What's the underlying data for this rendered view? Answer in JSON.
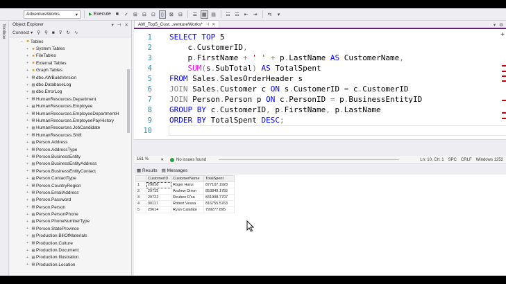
{
  "toolbar": {
    "database": "AdventureWorks",
    "execute_label": "Execute"
  },
  "toolbox": {
    "label": "Toolbox"
  },
  "object_explorer": {
    "title": "Object Explorer",
    "connect_label": "Connect",
    "tree": [
      {
        "label": "Tables",
        "type": "folder",
        "indent": 0,
        "expanded": true
      },
      {
        "label": "System Tables",
        "type": "folder",
        "indent": 1
      },
      {
        "label": "FileTables",
        "type": "folder",
        "indent": 1
      },
      {
        "label": "External Tables",
        "type": "folder",
        "indent": 1
      },
      {
        "label": "Graph Tables",
        "type": "folder",
        "indent": 1
      },
      {
        "label": "dbo.AWBuildVersion",
        "type": "table",
        "indent": 1
      },
      {
        "label": "dbo.DatabaseLog",
        "type": "table",
        "indent": 1
      },
      {
        "label": "dbo.ErrorLog",
        "type": "table",
        "indent": 1
      },
      {
        "label": "HumanResources.Department",
        "type": "table",
        "indent": 1
      },
      {
        "label": "HumanResources.Employee",
        "type": "table",
        "indent": 1
      },
      {
        "label": "HumanResources.EmployeeDepartmentH",
        "type": "table",
        "indent": 1
      },
      {
        "label": "HumanResources.EmployeePayHistory",
        "type": "table",
        "indent": 1
      },
      {
        "label": "HumanResources.JobCandidate",
        "type": "table",
        "indent": 1
      },
      {
        "label": "HumanResources.Shift",
        "type": "table",
        "indent": 1
      },
      {
        "label": "Person.Address",
        "type": "table",
        "indent": 1
      },
      {
        "label": "Person.AddressType",
        "type": "table",
        "indent": 1
      },
      {
        "label": "Person.BusinessEntity",
        "type": "table",
        "indent": 1
      },
      {
        "label": "Person.BusinessEntityAddress",
        "type": "table",
        "indent": 1
      },
      {
        "label": "Person.BusinessEntityContact",
        "type": "table",
        "indent": 1
      },
      {
        "label": "Person.ContactType",
        "type": "table",
        "indent": 1
      },
      {
        "label": "Person.CountryRegion",
        "type": "table",
        "indent": 1
      },
      {
        "label": "Person.EmailAddress",
        "type": "table",
        "indent": 1
      },
      {
        "label": "Person.Password",
        "type": "table",
        "indent": 1
      },
      {
        "label": "Person.Person",
        "type": "table",
        "indent": 1
      },
      {
        "label": "Person.PersonPhone",
        "type": "table",
        "indent": 1
      },
      {
        "label": "Person.PhoneNumberType",
        "type": "table",
        "indent": 1
      },
      {
        "label": "Person.StateProvince",
        "type": "table",
        "indent": 1
      },
      {
        "label": "Production.BillOfMaterials",
        "type": "table",
        "indent": 1
      },
      {
        "label": "Production.Culture",
        "type": "table",
        "indent": 1
      },
      {
        "label": "Production.Document",
        "type": "table",
        "indent": 1
      },
      {
        "label": "Production.Illustration",
        "type": "table",
        "indent": 1
      },
      {
        "label": "Production.Location",
        "type": "table",
        "indent": 1
      }
    ]
  },
  "editor": {
    "tab_title": "AW_Top5_Cust...ventureWorks*",
    "lines": [
      {
        "n": "1",
        "tokens": [
          [
            "kw",
            "SELECT TOP "
          ],
          [
            "id",
            "5"
          ]
        ]
      },
      {
        "n": "2",
        "tokens": [
          [
            "id",
            "    c"
          ],
          [
            "op",
            "."
          ],
          [
            "id",
            "CustomerID"
          ],
          [
            "op",
            ","
          ]
        ]
      },
      {
        "n": "3",
        "tokens": [
          [
            "id",
            "    p"
          ],
          [
            "op",
            "."
          ],
          [
            "id",
            "FirstName "
          ],
          [
            "op",
            "+ "
          ],
          [
            "str",
            "' '"
          ],
          [
            "op",
            " + "
          ],
          [
            "id",
            "p"
          ],
          [
            "op",
            "."
          ],
          [
            "id",
            "LastName "
          ],
          [
            "kw",
            "AS"
          ],
          [
            "id",
            " CustomerName"
          ],
          [
            "op",
            ","
          ]
        ]
      },
      {
        "n": "4",
        "tokens": [
          [
            "fn",
            "    SUM"
          ],
          [
            "op",
            "("
          ],
          [
            "id",
            "s"
          ],
          [
            "op",
            "."
          ],
          [
            "id",
            "SubTotal"
          ],
          [
            "op",
            ")"
          ],
          [
            "kw",
            " AS"
          ],
          [
            "id",
            " TotalSpent"
          ]
        ]
      },
      {
        "n": "5",
        "tokens": [
          [
            "kw",
            "FROM "
          ],
          [
            "id",
            "Sales"
          ],
          [
            "op",
            "."
          ],
          [
            "id",
            "SalesOrderHeader s"
          ]
        ]
      },
      {
        "n": "6",
        "tokens": [
          [
            "op",
            "JOIN "
          ],
          [
            "id",
            "Sales"
          ],
          [
            "op",
            "."
          ],
          [
            "id",
            "Customer c "
          ],
          [
            "kw",
            "ON"
          ],
          [
            "id",
            " s"
          ],
          [
            "op",
            "."
          ],
          [
            "id",
            "CustomerID "
          ],
          [
            "op",
            "="
          ],
          [
            "id",
            " c"
          ],
          [
            "op",
            "."
          ],
          [
            "id",
            "CustomerID"
          ]
        ]
      },
      {
        "n": "7",
        "tokens": [
          [
            "op",
            "JOIN "
          ],
          [
            "id",
            "Person"
          ],
          [
            "op",
            "."
          ],
          [
            "id",
            "Person p "
          ],
          [
            "kw",
            "ON"
          ],
          [
            "id",
            " c"
          ],
          [
            "op",
            "."
          ],
          [
            "id",
            "PersonID "
          ],
          [
            "op",
            "="
          ],
          [
            "id",
            " p"
          ],
          [
            "op",
            "."
          ],
          [
            "id",
            "BusinessEntityID"
          ]
        ]
      },
      {
        "n": "8",
        "tokens": [
          [
            "kw",
            "GROUP BY "
          ],
          [
            "id",
            "c"
          ],
          [
            "op",
            "."
          ],
          [
            "id",
            "CustomerID"
          ],
          [
            "op",
            ","
          ],
          [
            "id",
            " p"
          ],
          [
            "op",
            "."
          ],
          [
            "id",
            "FirstName"
          ],
          [
            "op",
            ","
          ],
          [
            "id",
            " p"
          ],
          [
            "op",
            "."
          ],
          [
            "id",
            "LastName"
          ]
        ]
      },
      {
        "n": "9",
        "tokens": [
          [
            "kw",
            "ORDER BY "
          ],
          [
            "id",
            "TotalSpent "
          ],
          [
            "kw",
            "DESC"
          ],
          [
            "op",
            ";"
          ]
        ]
      },
      {
        "n": "10",
        "tokens": []
      }
    ]
  },
  "status": {
    "zoom": "161 %",
    "issues": "No issues found",
    "position": "Ln: 10, Ch: 1",
    "indent": "SPC",
    "eol": "CRLF",
    "encoding": "Windows 1252"
  },
  "results": {
    "tab_results": "Results",
    "tab_messages": "Messages",
    "columns": [
      "CustomerID",
      "CustomerName",
      "TotalSpent"
    ],
    "rows": [
      [
        "1",
        "29818",
        "Roger Harui",
        "877107.1923"
      ],
      [
        "2",
        "29715",
        "Andrew Dixon",
        "853849.1755"
      ],
      [
        "3",
        "29722",
        "Reuben D'sa",
        "841908.7707"
      ],
      [
        "4",
        "30117",
        "Robert Vessa",
        "816755.5763"
      ],
      [
        "5",
        "29614",
        "Ryan Calafato",
        "799277.895"
      ]
    ]
  }
}
